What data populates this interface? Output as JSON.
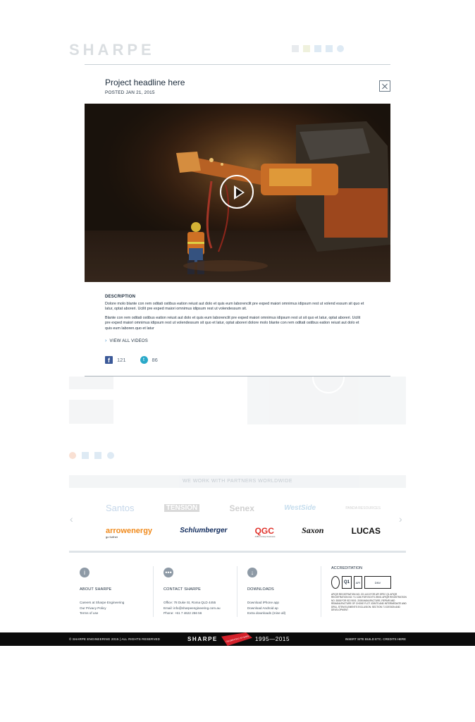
{
  "background": {
    "logo": "SHARPE",
    "topbar": {},
    "partners": {
      "title": "WE WORK WITH PARTNERS WORLDWIDE",
      "row1": [
        "Santos",
        "TENSION",
        "Senex",
        "WestSide",
        "PANDA RESOURCES"
      ],
      "row2": [
        "arrowenergy",
        "Schlumberger",
        "QGC",
        "Saxon",
        "LUCAS"
      ],
      "arrow_sub": "go further",
      "qgc_sub": "A BG Group business"
    },
    "footer": {
      "about": {
        "heading": "ABOUT SHARPE",
        "links": [
          "Careers at Sharpe Engineering",
          "Our Privacy Policy",
          "Terms of use"
        ]
      },
      "contact": {
        "heading": "CONTACT SHARPE",
        "links": [
          "Office: 78 Duke St, Roma QLD 4455",
          "Email: info@sharpeengineering.com.au",
          "Phone: +61 7 4622 256 56"
        ]
      },
      "downloads": {
        "heading": "DOWNLOADS",
        "links": [
          "Download iPhone app",
          "Download Android ap",
          "Extra downloads (mine all)"
        ]
      },
      "accreditation": {
        "heading": "ACCREDITATION",
        "badges": [
          "Q1",
          "API",
          "DNV"
        ],
        "text": "APIQR REGISTRATION NO: ZO-1413 FOR API SPEC Q1 APIQR REGISTRATION NO: Y1 1026 FOR ISO/TS 29001 APIQR REGISTRATION NO: 3508 FOR ISO 9001: 2008 MANUFACTURE, REPAIR AND REMANUFACTURE OF CHOKE FLOT JOINTS AND INTERMEDIATE AND DRILL STEM ELEMENTS EXCLUSION: SECTION 7.3 DESIGN AND DEVELOPMENT"
      }
    },
    "bottom_bar": {
      "copyright": "© SHARPE ENGINEERING 2015 | ALL RIGHTS RESERVED",
      "logo": "SHARPE",
      "ribbon": "CELEBRATING 20 YEARS",
      "years": "1995—2015",
      "credits": "INSERT SITE BUILD ETC. CREDITS HERE"
    }
  },
  "modal": {
    "title": "Project headline here",
    "date": "POSTED JAN 21, 2015",
    "description_heading": "DESCRIPTION",
    "paragraph1": "Dolore molo blante con rem oditati ostibus eation reiust aut dolo et quis eum laborenclit pre exped maiori omnimus idipsum rest ut volend essum sit quo et latur, optat aboreri. Ucilit pre exped maiori omnimus idipsum rest ut volendessum sit.",
    "paragraph2": "Blante con rem oditati ostibus eation reiust aut dolo et quis eum laborenclit pre exped maiori omnimus idipsum rest ut sit quo et latur, optat aboreri. Ucilit pre exped maiori omnimus idipsum rest ut volendessum sit quo et latur, optat aboreri dolore molo blante con rem oditati ostibus eation reiust aut dolo et quis eum laboren.quo et latur",
    "view_all": "VIEW ALL VIDEOS",
    "facebook_count": "121",
    "twitter_count": "86",
    "facebook_glyph": "f",
    "twitter_glyph": "t"
  },
  "colors": {
    "accent_blue": "#3b8cc7",
    "facebook": "#3b5998",
    "twitter": "#2aa9c9",
    "ribbon_red": "#d4202a"
  }
}
